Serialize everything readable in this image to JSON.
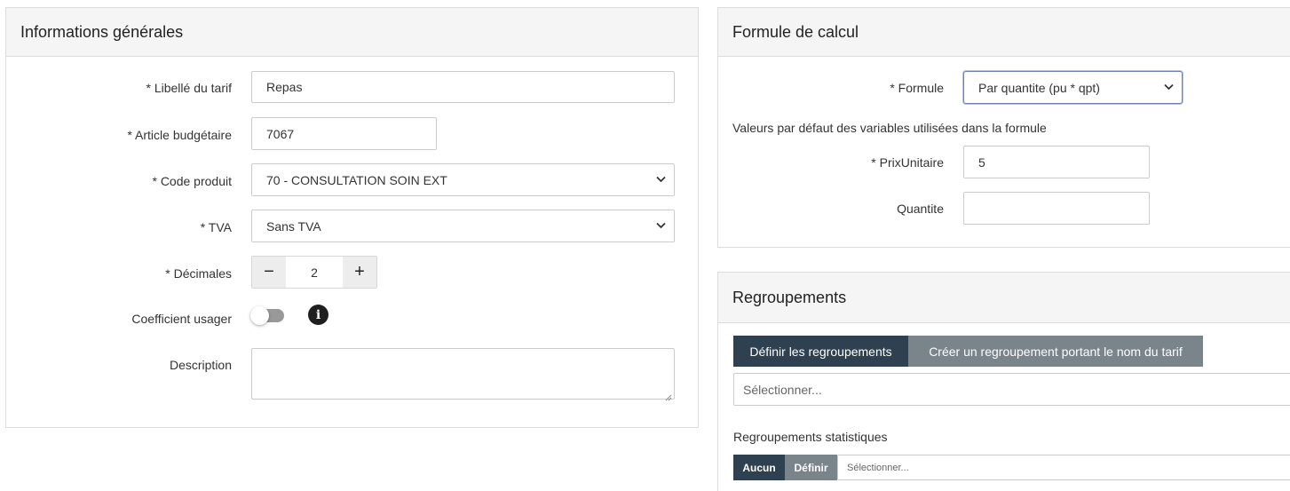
{
  "info_panel": {
    "title": "Informations générales",
    "libelle_label": "* Libellé du tarif",
    "libelle_value": "Repas",
    "article_label": "* Article budgétaire",
    "article_value": "7067",
    "code_label": "* Code produit",
    "code_value": "70 - CONSULTATION SOIN EXT",
    "tva_label": "* TVA",
    "tva_value": "Sans TVA",
    "decimales_label": "* Décimales",
    "decimales_minus": "−",
    "decimales_value": "2",
    "decimales_plus": "+",
    "coefficient_label": "Coefficient usager",
    "coefficient_enabled": false,
    "info_glyph": "i",
    "description_label": "Description",
    "description_value": ""
  },
  "formule_panel": {
    "title": "Formule de calcul",
    "formule_label": "* Formule",
    "formule_value": "Par quantite (pu * qpt)",
    "defaults_caption": "Valeurs par défaut des variables utilisées dans la formule",
    "prix_label": "* PrixUnitaire",
    "prix_value": "5",
    "quantite_label": "Quantite",
    "quantite_value": ""
  },
  "regroup_panel": {
    "title": "Regroupements",
    "define_button": "Définir les regroupements",
    "create_button": "Créer un regroupement portant le nom du tarif",
    "select_placeholder": "Sélectionner...",
    "stats_label": "Regroupements statistiques",
    "none_button": "Aucun",
    "define_small_button": "Définir",
    "stats_placeholder": "Sélectionner..."
  },
  "colors": {
    "dark_button": "#2f4050",
    "gray_button": "#7a848b",
    "panel_header": "#f5f5f5",
    "border": "#dddddd"
  },
  "icons": {
    "info": "info-circle-icon",
    "chevron": "chevron-down-icon",
    "resize": "resize-grip-icon"
  }
}
